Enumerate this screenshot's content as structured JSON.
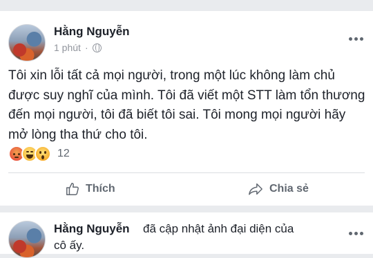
{
  "post1": {
    "author": "Hằng Nguyễn",
    "time": "1 phút",
    "text": "Tôi xin lỗi tất cả mọi người, trong một lúc không làm chủ được suy nghĩ của mình. Tôi đã viết một STT làm tổn thương đến mọi người, tôi đã biết tôi sai. Tôi mong mọi người hãy mở lòng tha thứ cho tôi.",
    "reactions": {
      "icons": [
        "angry-reaction-icon",
        "haha-reaction-icon",
        "wow-reaction-icon"
      ],
      "count": "12"
    },
    "like_label": "Thích",
    "share_label": "Chia sẻ"
  },
  "post2": {
    "author": "Hằng Nguyễn",
    "action_line1": "đã cập nhật ảnh đại diện của",
    "action_line2": "cô ấy."
  },
  "colors": {
    "background": "#e9ebee",
    "card": "#ffffff",
    "text": "#1d2129",
    "meta": "#90949c",
    "button": "#606770"
  }
}
